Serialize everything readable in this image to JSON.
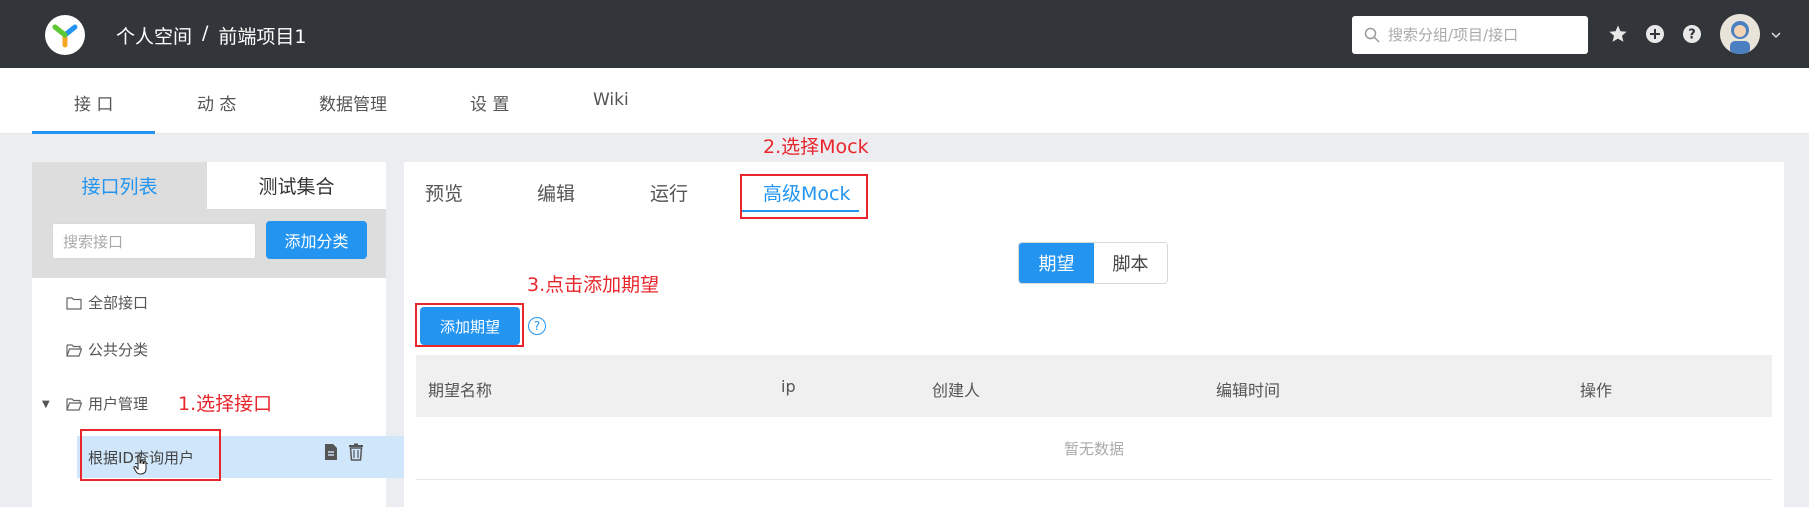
{
  "header": {
    "breadcrumb": [
      "个人空间",
      "前端项目1"
    ],
    "breadcrumb_separator": "/",
    "search_placeholder": "搜索分组/项目/接口",
    "icons": [
      "star-icon",
      "plus-circle-icon",
      "help-icon",
      "avatar",
      "chevron-down-icon"
    ]
  },
  "subnav": {
    "tabs": [
      "接 口",
      "动 态",
      "数据管理",
      "设 置",
      "Wiki"
    ],
    "active": "接 口"
  },
  "left_panel": {
    "tabs": [
      "接口列表",
      "测试集合"
    ],
    "active_tab": "接口列表",
    "search_placeholder": "搜索接口",
    "add_category_label": "添加分类",
    "tree": [
      {
        "label": "全部接口",
        "icon": "folder-icon"
      },
      {
        "label": "公共分类",
        "icon": "folder-open-icon"
      },
      {
        "label": "用户管理",
        "icon": "folder-open-icon",
        "expanded": true,
        "children": [
          {
            "label": "根据ID查询用户",
            "selected": true
          }
        ]
      }
    ]
  },
  "right_panel": {
    "tabs": [
      "预览",
      "编辑",
      "运行",
      "高级Mock"
    ],
    "active_tab": "高级Mock",
    "segment": {
      "options": [
        "期望",
        "脚本"
      ],
      "selected": "期望"
    },
    "add_expectation_label": "添加期望",
    "help_glyph": "?",
    "table": {
      "columns": [
        "期望名称",
        "ip",
        "创建人",
        "编辑时间",
        "操作"
      ],
      "empty_text": "暂无数据"
    }
  },
  "annotations": {
    "step1": "1.选择接口",
    "step2": "2.选择Mock",
    "step3": "3.点击添加期望",
    "color": "#e8262c"
  },
  "colors": {
    "topbar": "#32363a",
    "primary": "#2395f1",
    "selected_row": "#cfe6fb"
  }
}
